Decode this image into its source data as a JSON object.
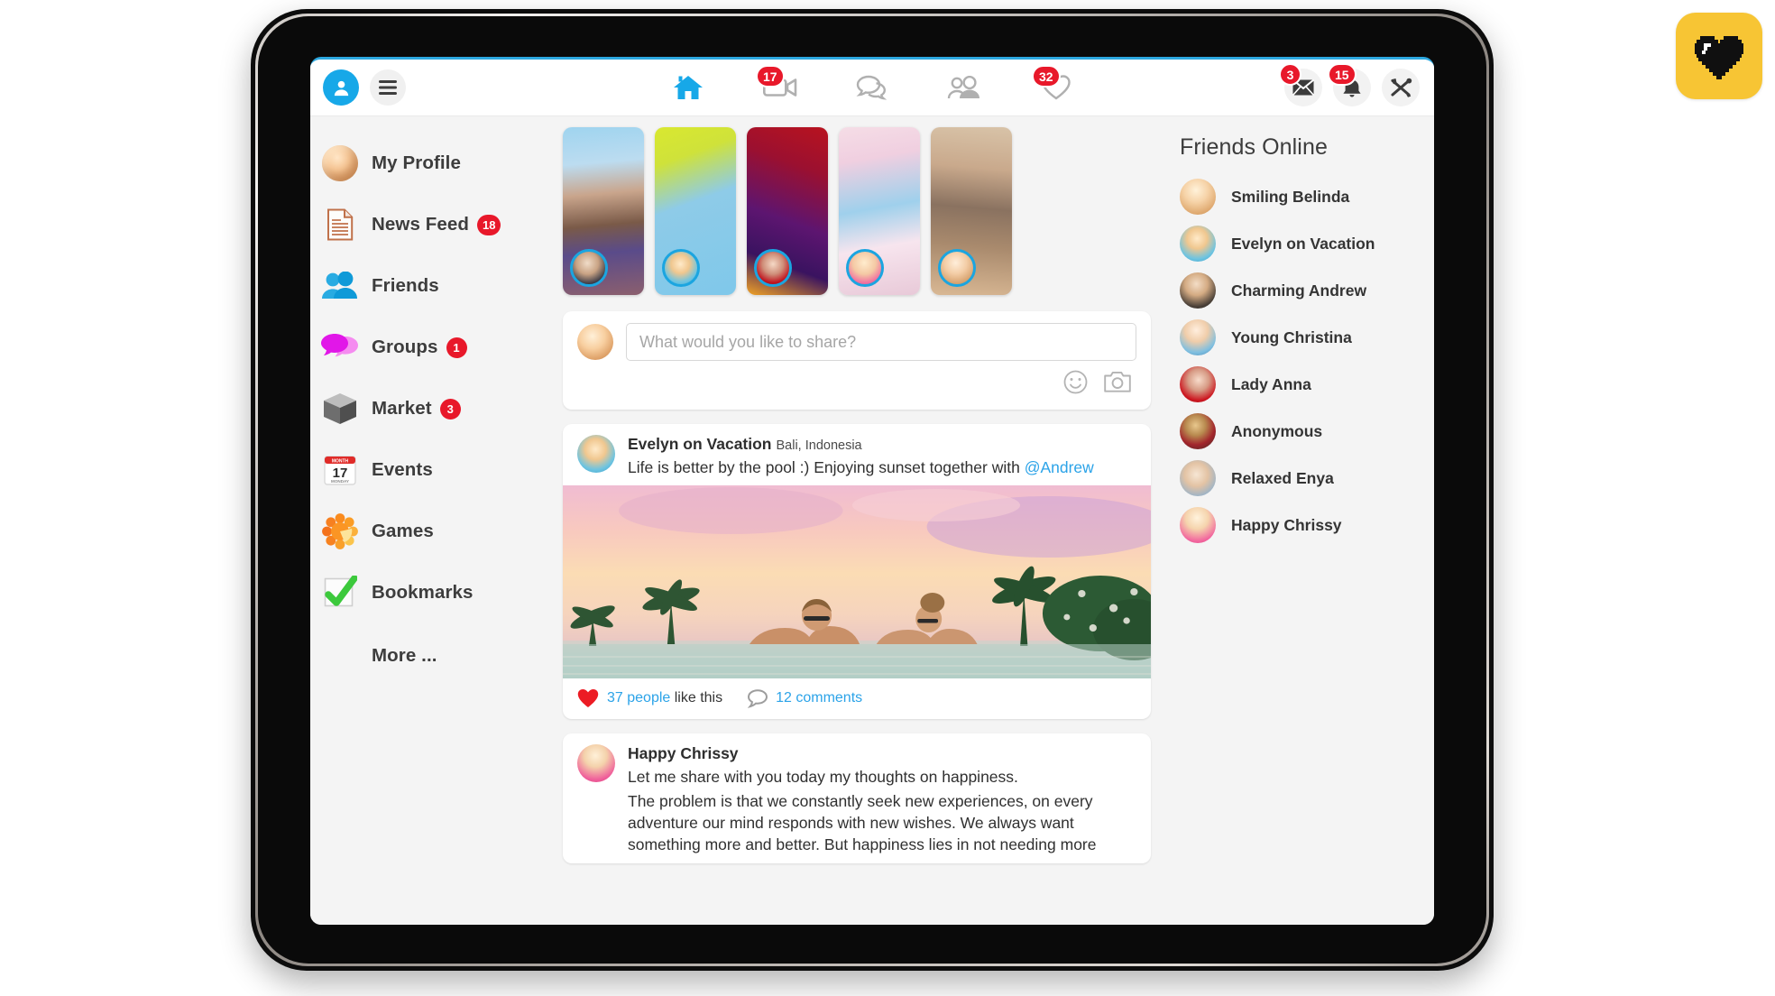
{
  "app": {
    "logo_icon": "pixel-heart-icon",
    "logo_bg": "#f7c534",
    "accent": "#2ba3e8",
    "badge_color": "#e8182a"
  },
  "topbar": {
    "profile_icon": "user-avatar-icon",
    "menu_icon": "hamburger-icon",
    "nav": [
      {
        "icon": "home-icon",
        "label": "Home",
        "badge": ""
      },
      {
        "icon": "video-icon",
        "label": "Videos",
        "badge": "17"
      },
      {
        "icon": "chat-icon",
        "label": "Chats",
        "badge": ""
      },
      {
        "icon": "people-icon",
        "label": "People",
        "badge": ""
      },
      {
        "icon": "heart-icon",
        "label": "Likes",
        "badge": "32"
      }
    ],
    "actions": [
      {
        "icon": "envelope-icon",
        "label": "Messages",
        "badge": "3"
      },
      {
        "icon": "bell-icon",
        "label": "Notifications",
        "badge": "15"
      },
      {
        "icon": "tools-icon",
        "label": "Settings",
        "badge": ""
      }
    ]
  },
  "sidebar": {
    "items": [
      {
        "label": "My Profile",
        "icon": "profile-photo-icon",
        "badge": ""
      },
      {
        "label": "News Feed",
        "icon": "document-icon",
        "badge": "18"
      },
      {
        "label": "Friends",
        "icon": "two-people-icon",
        "badge": ""
      },
      {
        "label": "Groups",
        "icon": "speech-bubbles-icon",
        "badge": "1"
      },
      {
        "label": "Market",
        "icon": "box-icon",
        "badge": "3"
      },
      {
        "label": "Events",
        "icon": "calendar-icon",
        "badge": ""
      },
      {
        "label": "Games",
        "icon": "flower-icon",
        "badge": ""
      },
      {
        "label": "Bookmarks",
        "icon": "checkmark-icon",
        "badge": ""
      }
    ],
    "more_label": "More ...",
    "calendar_day": "17",
    "calendar_month": "MONTH",
    "calendar_weekday": "MONDAY"
  },
  "stories": [
    {
      "name": "Couple selfie story",
      "avatar": "man-in-tuxedo"
    },
    {
      "name": "Palm leaf story",
      "avatar": "blonde-woman-beach"
    },
    {
      "name": "Bokeh lights story",
      "avatar": "dark-haired-woman"
    },
    {
      "name": "Cherry blossom story",
      "avatar": "blonde-woman-pink"
    },
    {
      "name": "Fitness woman story",
      "avatar": "fitness-woman"
    }
  ],
  "composer": {
    "placeholder": "What would you like to share?",
    "value": "",
    "emoji_icon": "smiley-icon",
    "camera_icon": "camera-icon"
  },
  "posts": [
    {
      "author": "Evelyn on Vacation",
      "location": "Bali, Indonesia",
      "text_before": "Life is better by the pool :) Enjoying sunset together with ",
      "mention": "@Andrew",
      "likes_count": "37 people",
      "likes_suffix": "like this",
      "comments": "12 comments",
      "heart_icon": "heart-icon",
      "comment_icon": "comment-bubble-icon",
      "image_alt": "Couple in infinity pool at sunset with palm trees"
    },
    {
      "author": "Happy Chrissy",
      "line1": "Let me share with you today my thoughts on happiness.",
      "line2": "The problem is that we constantly seek new experiences, on every adventure our mind responds with new wishes. We always want something more and better. But happiness lies in not needing more"
    }
  ],
  "rail": {
    "title": "Friends Online",
    "friends": [
      {
        "name": "Smiling Belinda",
        "avatar": "blonde-smiling"
      },
      {
        "name": "Evelyn on Vacation",
        "avatar": "beach-cocktail"
      },
      {
        "name": "Charming Andrew",
        "avatar": "man-tuxedo"
      },
      {
        "name": "Young Christina",
        "avatar": "sunglasses-blonde"
      },
      {
        "name": "Lady Anna",
        "avatar": "red-background-brunette"
      },
      {
        "name": "Anonymous",
        "avatar": "masked-woman"
      },
      {
        "name": "Relaxed Enya",
        "avatar": "resting-woman"
      },
      {
        "name": "Happy Chrissy",
        "avatar": "pink-jacket-blonde"
      }
    ]
  }
}
